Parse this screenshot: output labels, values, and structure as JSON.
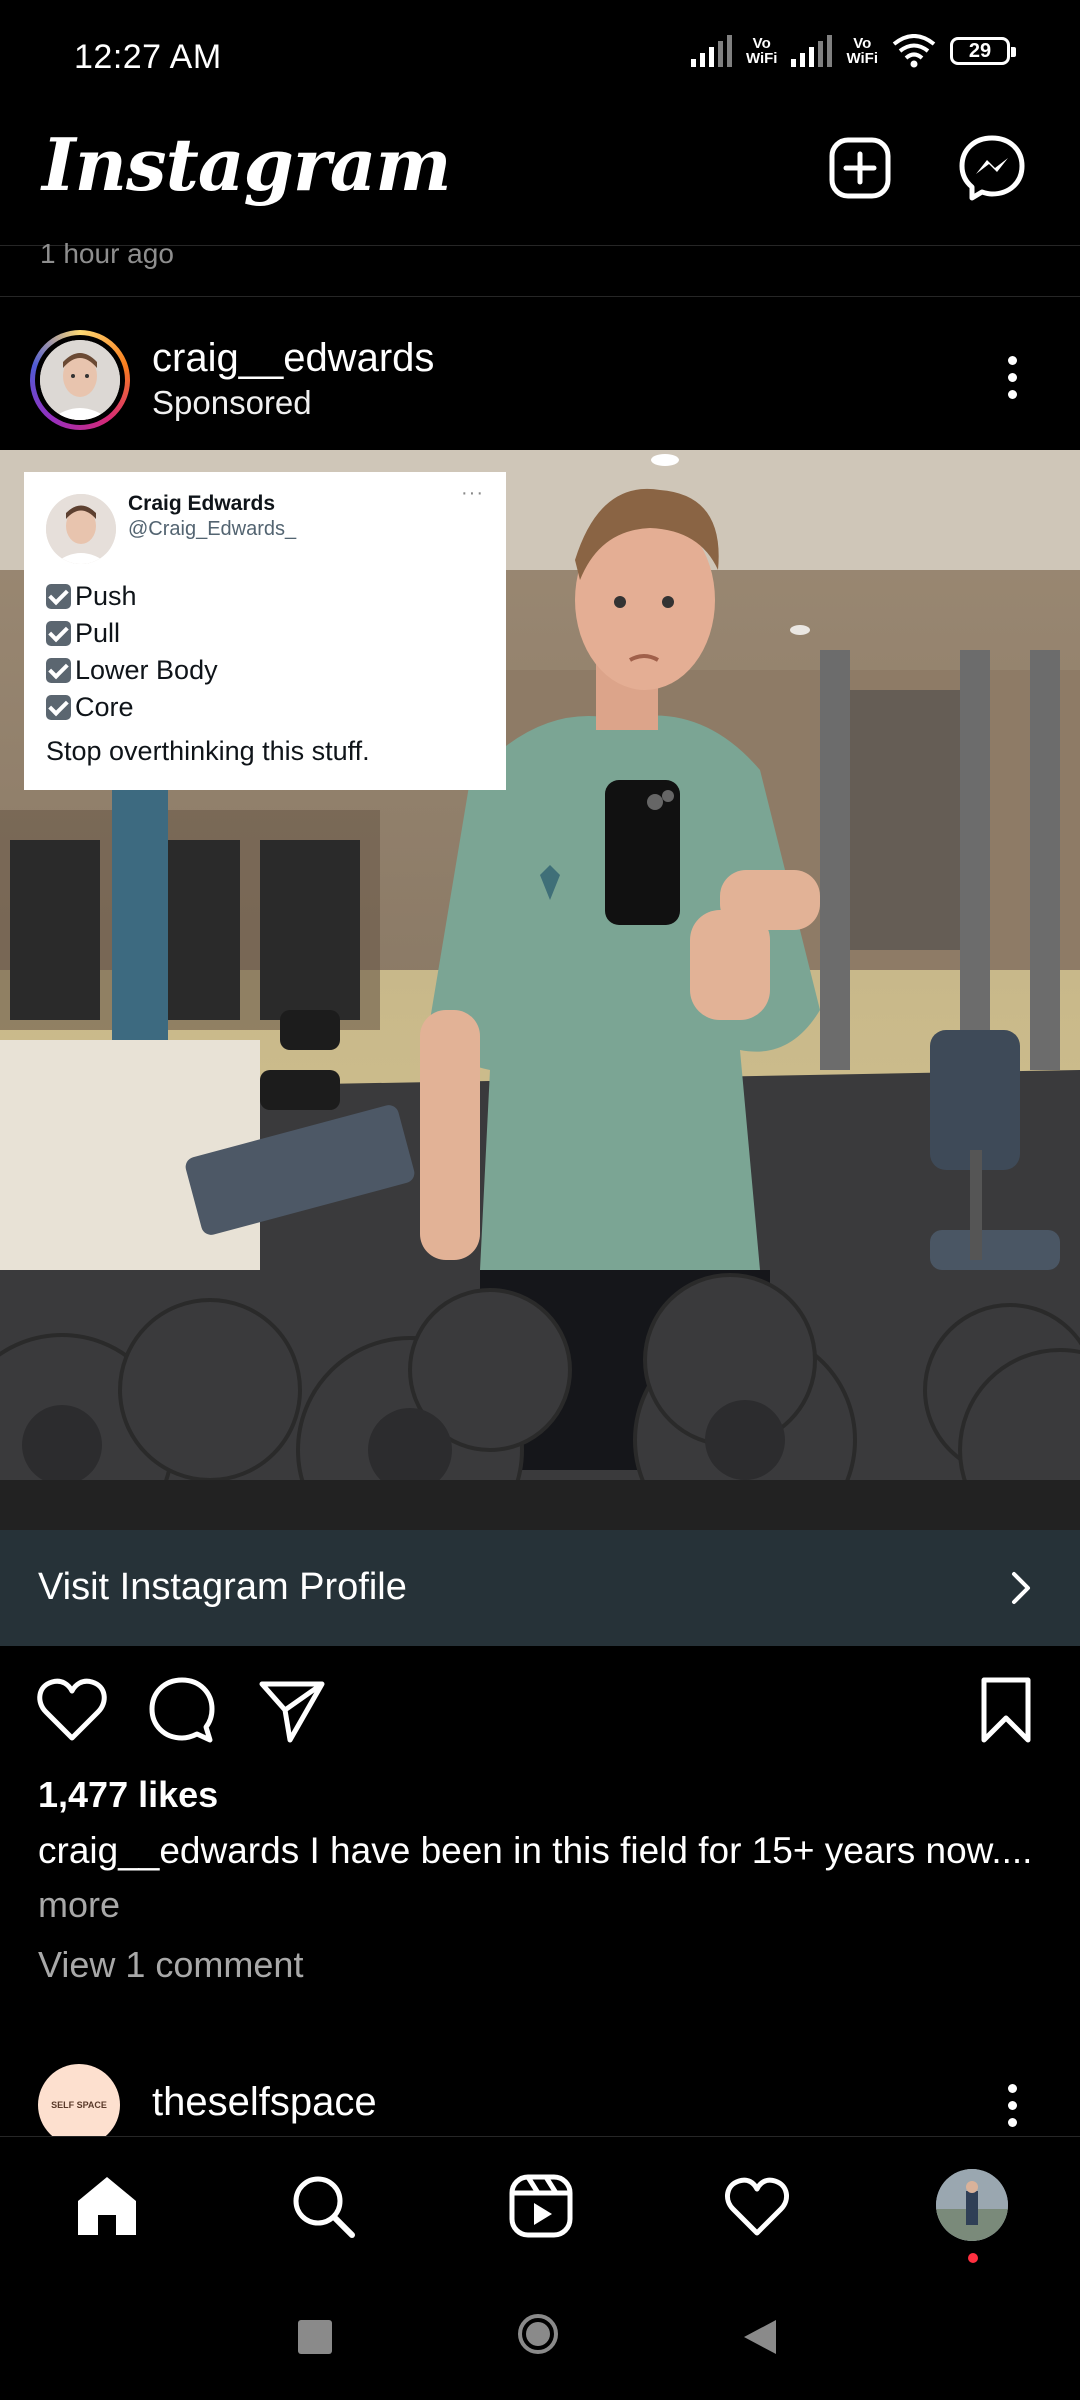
{
  "status_bar": {
    "time": "12:27 AM",
    "vowifi_1": "Vo\nWiFi",
    "vowifi_2": "Vo\nWiFi",
    "battery": "29"
  },
  "header": {
    "app_name": "Instagram",
    "create_icon": "plus-square-icon",
    "messenger_icon": "messenger-icon"
  },
  "previous_post": {
    "time_ago": "1 hour ago"
  },
  "post": {
    "username": "craig__edwards",
    "sponsored_label": "Sponsored",
    "tweet": {
      "name": "Craig Edwards",
      "handle": "@Craig_Edwards_",
      "more": "···",
      "items": [
        "Push",
        "Pull",
        "Lower Body",
        "Core"
      ],
      "text": "Stop overthinking this stuff."
    },
    "cta_label": "Visit Instagram Profile",
    "likes": "1,477 likes",
    "caption_user": "craig__edwards",
    "caption_text": " I have been in this field for 15+ years now....",
    "more_label": "more",
    "view_comments": "View 1 comment"
  },
  "next_post": {
    "username": "theselfspace",
    "avatar_text": "SELF SPACE"
  },
  "bottom_nav": [
    "home-icon",
    "search-icon",
    "reels-icon",
    "activity-heart-icon",
    "profile-avatar"
  ],
  "colors": {
    "background": "#000000",
    "cta_bar": "#263238",
    "secondary_text": "#a8a8a8",
    "notification_dot": "#ff3040"
  }
}
